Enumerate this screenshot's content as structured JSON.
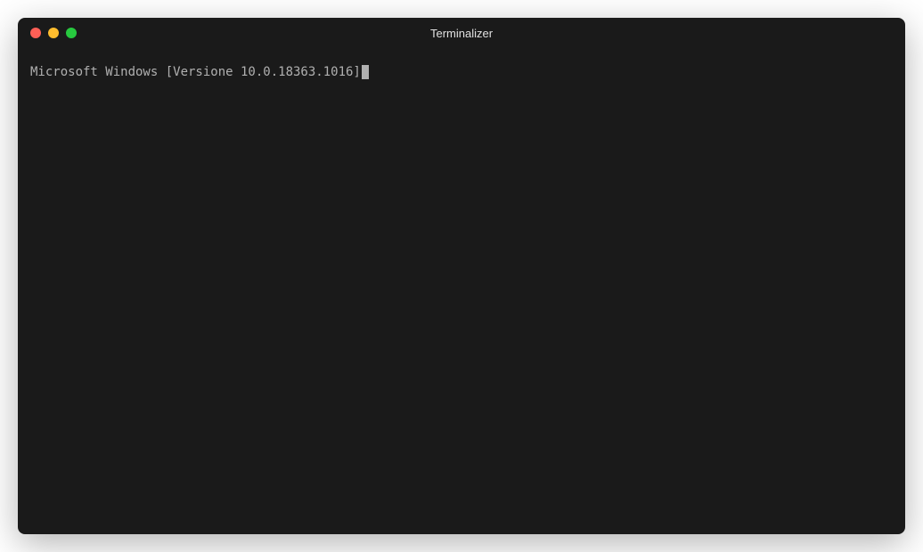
{
  "window": {
    "title": "Terminalizer"
  },
  "terminal": {
    "lines": [
      "Microsoft Windows [Versione 10.0.18363.1016]"
    ]
  }
}
